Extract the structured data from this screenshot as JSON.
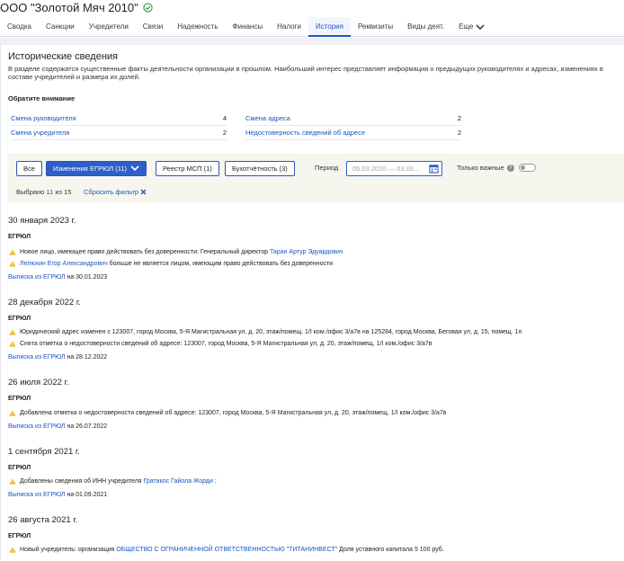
{
  "company": {
    "title": "ООО \"Золотой Мяч 2010\""
  },
  "tabs": [
    {
      "label": "Сводка"
    },
    {
      "label": "Санкции"
    },
    {
      "label": "Учредители"
    },
    {
      "label": "Связи"
    },
    {
      "label": "Надежность"
    },
    {
      "label": "Финансы"
    },
    {
      "label": "Налоги"
    },
    {
      "label": "История",
      "active": true
    },
    {
      "label": "Реквизиты"
    },
    {
      "label": "Виды деят."
    },
    {
      "label": "Еще"
    }
  ],
  "section": {
    "title": "Исторические сведения",
    "description": "В разделе содержатся существенные факты деятельности организации в прошлом. Наибольший интерес представляет информация о предыдущих руководителях и адресах, изменениях в составе учредителей и размера их долей."
  },
  "notice": {
    "title": "Обратите внимание",
    "left": [
      {
        "label": "Смена руководителя",
        "count": "4"
      },
      {
        "label": "Смена учредителя",
        "count": "2"
      }
    ],
    "right": [
      {
        "label": "Смена адреса",
        "count": "2"
      },
      {
        "label": "Недостоверность сведений об адресе",
        "count": "2"
      }
    ]
  },
  "filters": {
    "all_label": "Все",
    "egrul_label": "Изменения ЕГРЮЛ (11)",
    "msp_label": "Реестр МСП (1)",
    "buh_label": "Бухотчётность (3)",
    "period_label": "Период",
    "date_placeholder": "05.03.2020 — 03.03...",
    "only_important_label": "Только важные",
    "selected_prefix": "Выбрано",
    "selected_count": "11",
    "selected_suffix": "из 15",
    "reset_label": "Сбросить фильтр"
  },
  "events": [
    {
      "date": "30 января 2023 г.",
      "source": "ЕГРЮЛ",
      "items": [
        {
          "text": "Новое лицо, имеющее право действовать без доверенности: Генеральный директор ",
          "link": "Таран Артур Эдуардович",
          "after": ""
        },
        {
          "text": "",
          "link": "Лелюхин Егор Александрович",
          "after": " больше не является лицом, имеющим право действовать без доверенности"
        }
      ],
      "extract_link": "Выписка из ЕГРЮЛ",
      "extract_date": "на 30.01.2023"
    },
    {
      "date": "28 декабря 2022 г.",
      "source": "ЕГРЮЛ",
      "items": [
        {
          "text": "Юридический адрес изменен с 123007, город Москва, 5-Я Магистральная ул, д. 20, этаж/помещ. 1/I ком./офис 3/а7в на 125284, город Москва, Беговая ул, д. 15, помещ. 1п",
          "link": "",
          "after": ""
        },
        {
          "text": "Снята отметка о недостоверности сведений об адресе: 123007, город Москва, 5-Я Магистральная ул, д. 20, этаж/помещ. 1/I ком./офис 3/а7в",
          "link": "",
          "after": ""
        }
      ],
      "extract_link": "Выписка из ЕГРЮЛ",
      "extract_date": "на 28.12.2022"
    },
    {
      "date": "26 июля 2022 г.",
      "source": "ЕГРЮЛ",
      "items": [
        {
          "text": "Добавлена отметка о недостоверности сведений об адресе: 123007, город Москва, 5-Я Магистральная ул, д. 20, этаж/помещ. 1/I ком./офис 3/а7в",
          "link": "",
          "after": ""
        }
      ],
      "extract_link": "Выписка из ЕГРЮЛ",
      "extract_date": "на 26.07.2022"
    },
    {
      "date": "1 сентября 2021 г.",
      "source": "ЕГРЮЛ",
      "items": [
        {
          "text": "Добавлены сведения об ИНН учредителя ",
          "link": "Гратакос Гайола Жорди",
          "after": " :"
        }
      ],
      "extract_link": "Выписка из ЕГРЮЛ",
      "extract_date": "на 01.09.2021"
    },
    {
      "date": "26 августа 2021 г.",
      "source": "ЕГРЮЛ",
      "items": [
        {
          "text": "Новый учредитель: организация ",
          "link": "ОБЩЕСТВО С ОГРАНИЧЕННОЙ ОТВЕТСТВЕННОСТЬЮ \"ТИТАНИНВЕСТ\"",
          "after": " Доля уставного капитала 5 100 руб."
        }
      ],
      "extract_link": "",
      "extract_date": ""
    }
  ]
}
